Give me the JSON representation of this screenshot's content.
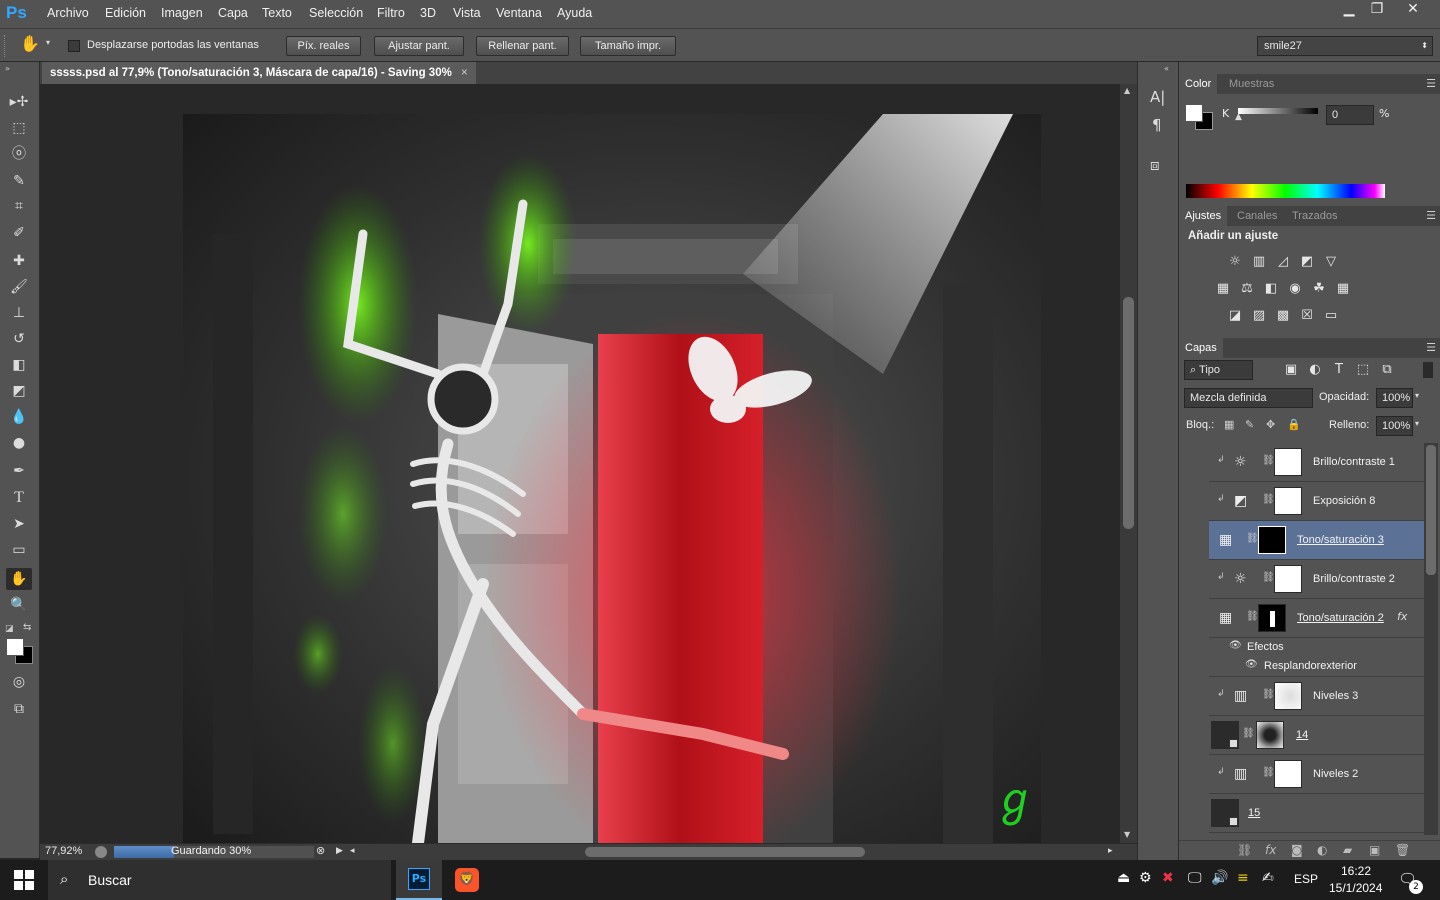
{
  "app": {
    "logo": "Ps"
  },
  "menu": [
    "Archivo",
    "Edición",
    "Imagen",
    "Capa",
    "Texto",
    "Selección",
    "Filtro",
    "3D",
    "Vista",
    "Ventana",
    "Ayuda"
  ],
  "window_controls": {
    "minimize": "▁",
    "restore": "❐",
    "close": "✕"
  },
  "options_bar": {
    "scroll_all_checkbox": "Desplazarse portodas las ventanas",
    "buttons": [
      "Píx. reales",
      "Ajustar pant.",
      "Rellenar pant.",
      "Tamaño impr."
    ],
    "workspace": "smile27"
  },
  "document": {
    "tab_title": "sssss.psd al 77,9% (Tono/saturación 3, Máscara de capa/16) - Saving 30%",
    "tab_close": "×"
  },
  "status": {
    "zoom": "77,92%",
    "progress_text": "Guardando 30%",
    "progress_fraction": 0.3
  },
  "artwork": {
    "signature_mark": "ℊ"
  },
  "color_panel": {
    "tabs": [
      "Color",
      "Muestras"
    ],
    "channel_label": "K",
    "channel_value": "0",
    "unit": "%"
  },
  "adjustments_panel": {
    "tabs": [
      "Ajustes",
      "Canales",
      "Trazados"
    ],
    "title": "Añadir un ajuste"
  },
  "layers_panel": {
    "tab": "Capas",
    "filter": "Tipo",
    "blend_mode": "Mezcla definida",
    "opacity_label": "Opacidad:",
    "opacity_value": "100%",
    "lock_label": "Bloq.:",
    "fill_label": "Relleno:",
    "fill_value": "100%",
    "effects_label": "Efectos",
    "effect_name": "Resplandorexterior",
    "layers": [
      {
        "name": "Brillo/contraste 1",
        "icon": "brightness-icon",
        "selected": false
      },
      {
        "name": "Exposición 8",
        "icon": "exposure-icon",
        "selected": false
      },
      {
        "name": "Tono/saturación 3",
        "icon": "hue-saturation-icon",
        "selected": true
      },
      {
        "name": "Brillo/contraste 2",
        "icon": "brightness-icon",
        "selected": false
      },
      {
        "name": "Tono/saturación 2",
        "icon": "hue-saturation-icon",
        "selected": false
      },
      {
        "name": "Niveles 3",
        "icon": "levels-icon",
        "selected": false
      },
      {
        "name": "14",
        "icon": "smart-object-icon",
        "selected": false
      },
      {
        "name": "Niveles 2",
        "icon": "levels-icon",
        "selected": false
      },
      {
        "name": "15",
        "icon": "smart-object-icon",
        "selected": false
      }
    ]
  },
  "taskbar": {
    "search_placeholder": "Buscar",
    "language": "ESP",
    "time": "16:22",
    "date": "15/1/2024",
    "notifications": "2"
  }
}
